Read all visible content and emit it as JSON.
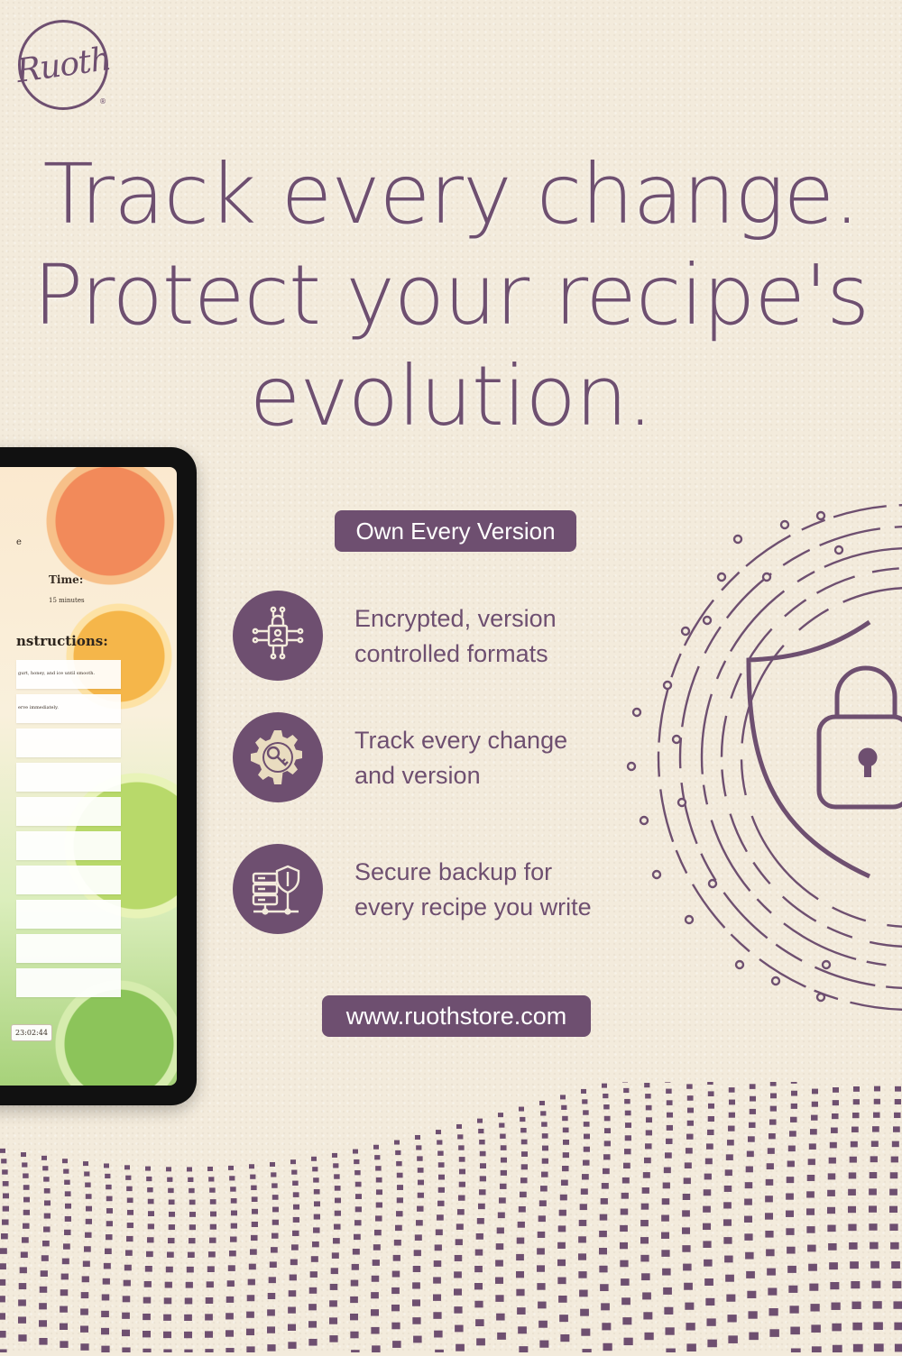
{
  "brand": {
    "logo_text": "Ruoth",
    "registered_mark": "®"
  },
  "headline": {
    "line1": "Track every change.",
    "line2": "Protect your recipe's",
    "line3": "evolution."
  },
  "badge": "Own Every Version",
  "features": [
    {
      "line1": "Encrypted, version",
      "line2": "controlled formats",
      "icon": "encrypted-circuit-lock-icon"
    },
    {
      "line1": "Track every change",
      "line2": "and version",
      "icon": "gear-key-icon"
    },
    {
      "line1": "Secure backup for",
      "line2": "every recipe you write",
      "icon": "server-shield-icon"
    }
  ],
  "website": "www.ruothstore.com",
  "tablet_screen": {
    "partial_label": "e",
    "time_label": "Time:",
    "time_value": "15 minutes",
    "instructions_heading": "nstructions:",
    "steps": [
      "gurt, honey, and ice until smooth.",
      "erve immediately.",
      "",
      "",
      "",
      "",
      "",
      "",
      "",
      ""
    ],
    "timestamp": "23:02:44"
  },
  "colors": {
    "accent": "#6e4f70",
    "background": "#f3ebdc"
  }
}
